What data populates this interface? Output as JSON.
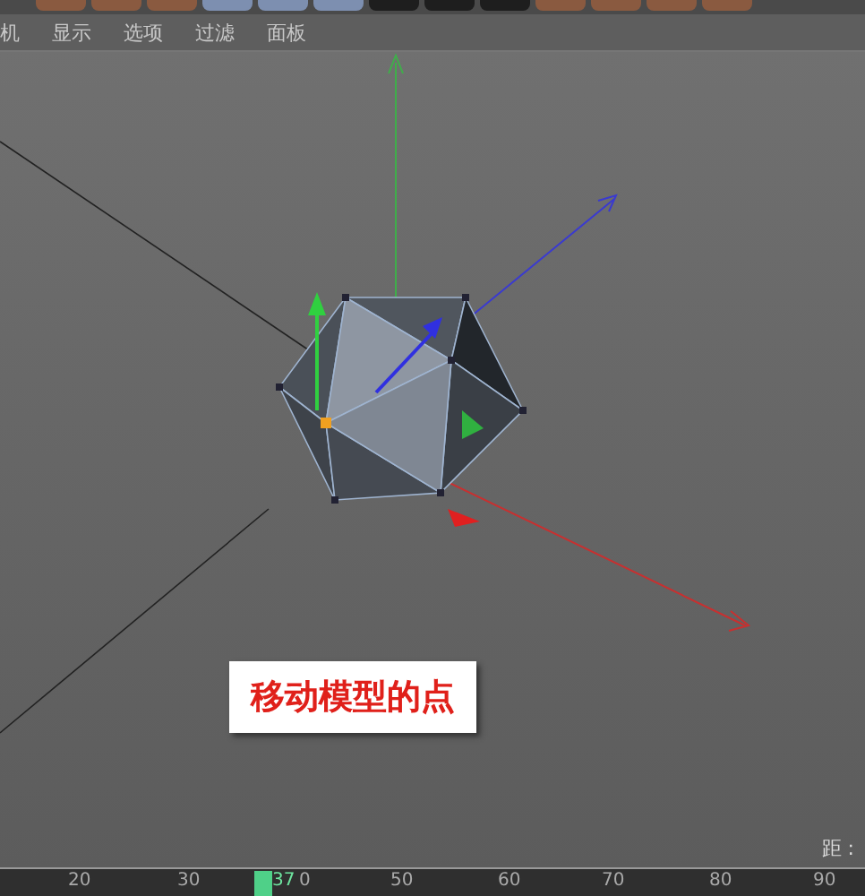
{
  "menu": [
    {
      "label": "机"
    },
    {
      "label": "显示"
    },
    {
      "label": "选项"
    },
    {
      "label": "过滤"
    },
    {
      "label": "面板"
    }
  ],
  "viewport": {
    "caption": "移动模型的点",
    "status_fragment": "距 :"
  },
  "timeline": {
    "current_frame": "37",
    "ticks": [
      "20",
      "30",
      "0",
      "50",
      "60",
      "70",
      "80",
      "90"
    ]
  }
}
